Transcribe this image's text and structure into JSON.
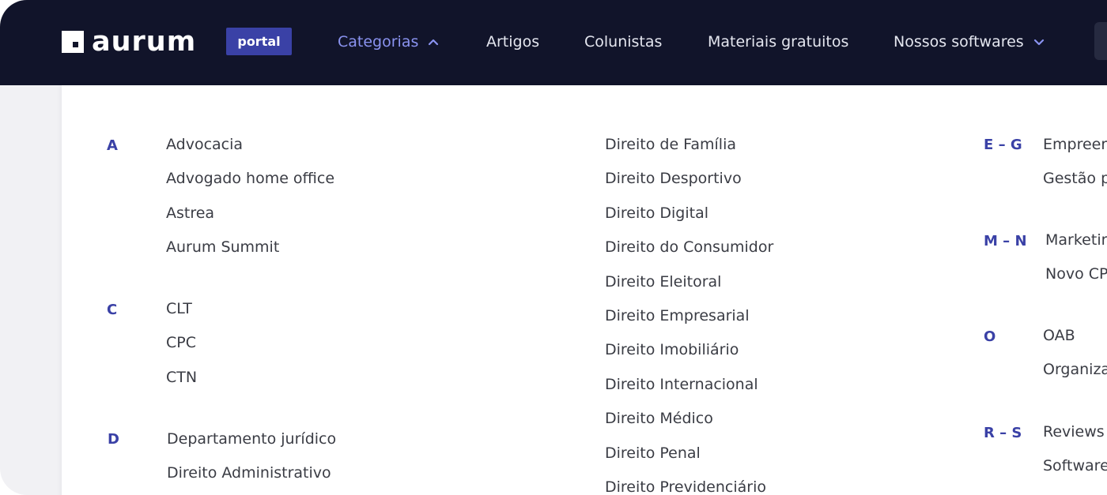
{
  "header": {
    "logo_text": "aurum",
    "badge": "portal",
    "nav": [
      {
        "label": "Categorias",
        "active": true,
        "chevron": "chevron-up-icon"
      },
      {
        "label": "Artigos"
      },
      {
        "label": "Colunistas"
      },
      {
        "label": "Materiais gratuitos"
      },
      {
        "label": "Nossos softwares",
        "chevron": "chevron-down-icon"
      }
    ]
  },
  "colors": {
    "nav_background": "#11142a",
    "accent": "#3a41a6",
    "active_nav": "#8a93f0",
    "item_text": "#3a3c44"
  },
  "dropdown": {
    "col1": [
      {
        "letter": "A",
        "items": [
          "Advocacia",
          "Advogado home office",
          "Astrea",
          "Aurum Summit"
        ]
      },
      {
        "letter": "C",
        "items": [
          "CLT",
          "CPC",
          "CTN"
        ]
      },
      {
        "letter": "D",
        "items": [
          "Departamento jurídico",
          "Direito Administrativo"
        ]
      }
    ],
    "col2": {
      "items": [
        "Direito de Família",
        "Direito Desportivo",
        "Direito Digital",
        "Direito do Consumidor",
        "Direito Eleitoral",
        "Direito Empresarial",
        "Direito Imobiliário",
        "Direito Internacional",
        "Direito Médico",
        "Direito Penal",
        "Direito Previdenciário"
      ]
    },
    "col3": [
      {
        "letter": "E – G",
        "items": [
          "Empreer",
          "Gestão p"
        ]
      },
      {
        "letter": "M – N",
        "items": [
          "Marketir",
          "Novo CP"
        ]
      },
      {
        "letter": "O",
        "items": [
          "OAB",
          "Organiza"
        ]
      },
      {
        "letter": "R – S",
        "items": [
          "Reviews",
          "Software"
        ]
      }
    ]
  }
}
